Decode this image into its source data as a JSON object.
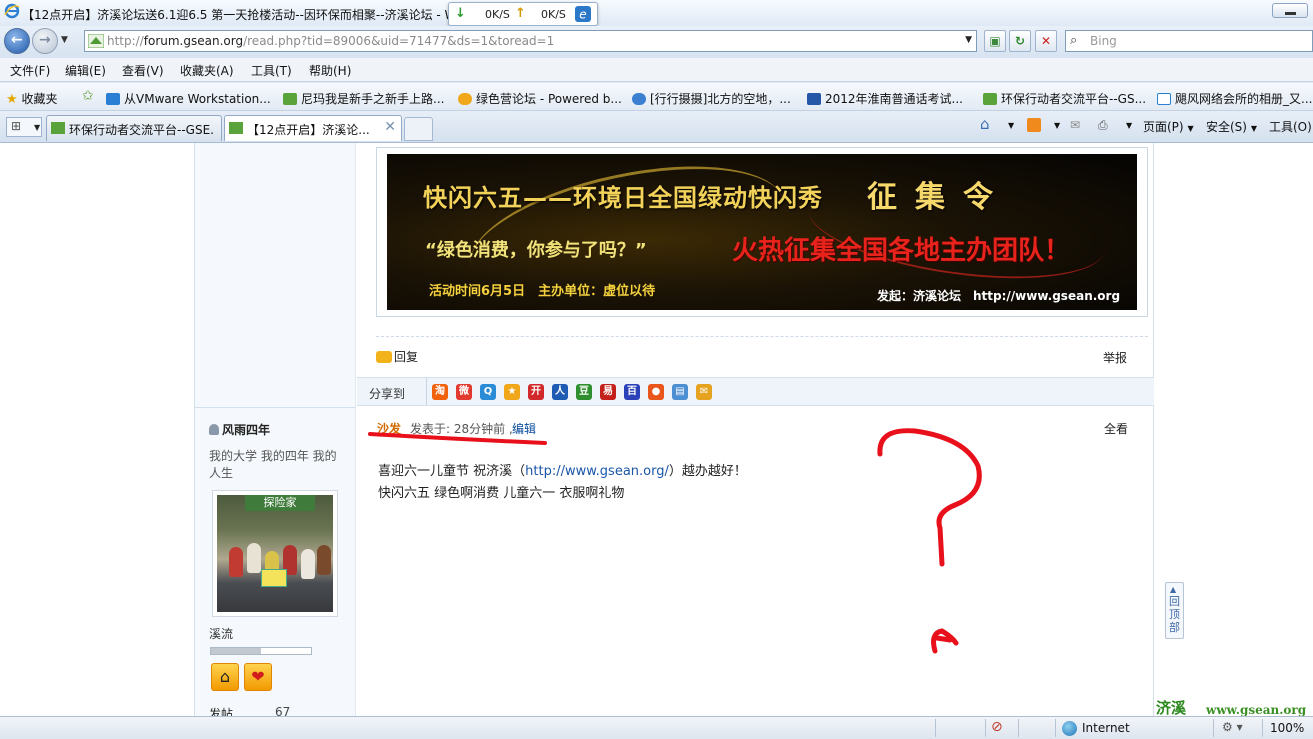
{
  "window": {
    "title": "【12点开启】济溪论坛送6.1迎6.5 第一天抢楼活动--因环保而相聚--济溪论坛 - W",
    "download_speed": "0K/S",
    "upload_speed": "0K/S"
  },
  "address_bar": {
    "url_prefix": "http://",
    "url_host": "forum.gsean.org",
    "url_path": "/read.php?tid=89006&uid=71477&ds=1&toread=1",
    "search_placeholder": "Bing"
  },
  "menu": [
    {
      "label": "文件(F)"
    },
    {
      "label": "编辑(E)"
    },
    {
      "label": "查看(V)"
    },
    {
      "label": "收藏夹(A)"
    },
    {
      "label": "工具(T)"
    },
    {
      "label": "帮助(H)"
    }
  ],
  "favorites": {
    "label": "收藏夹",
    "items": [
      {
        "label": "从VMware Workstation..."
      },
      {
        "label": "尼玛我是新手之新手上路..."
      },
      {
        "label": "绿色营论坛 - Powered b..."
      },
      {
        "label": "[行行摄摄]北方的空地，..."
      },
      {
        "label": "2012年淮南普通话考试..."
      },
      {
        "label": "环保行动者交流平台--GS..."
      },
      {
        "label": "飓风网络会所的相册_又..."
      }
    ]
  },
  "tabs": [
    {
      "label": "环保行动者交流平台--GSE..."
    },
    {
      "label": "【12点开启】济溪论..."
    }
  ],
  "commands": {
    "page": "页面(P)",
    "safety": "安全(S)",
    "tools": "工具(O)"
  },
  "banner": {
    "title": "快闪六五——环境日全国绿动快闪秀",
    "call": "征集令",
    "slogan": "“绿色消费，你参与了吗？”",
    "recruit": "火热征集全国各地主办团队！",
    "date_sponsor": "活动时间6月5日　主办单位：虚位以待",
    "initiator": "发起：济溪论坛　http://www.gsean.org"
  },
  "post_actions": {
    "reply": "回复",
    "report": "举报",
    "share_label": "分享到"
  },
  "share_icons": [
    {
      "name": "taobao",
      "glyph": "淘",
      "color": "#f2620b"
    },
    {
      "name": "weibo",
      "glyph": "微",
      "color": "#e23a2e"
    },
    {
      "name": "qzone",
      "glyph": "Q",
      "color": "#2a8bd6"
    },
    {
      "name": "favorite",
      "glyph": "★",
      "color": "#f0a81a"
    },
    {
      "name": "kaixin",
      "glyph": "开",
      "color": "#d3282b"
    },
    {
      "name": "renren",
      "glyph": "人",
      "color": "#1e5bb2"
    },
    {
      "name": "douban",
      "glyph": "豆",
      "color": "#2f8f2f"
    },
    {
      "name": "yixin",
      "glyph": "易",
      "color": "#c5211c"
    },
    {
      "name": "baidu",
      "glyph": "百",
      "color": "#2a41b8"
    },
    {
      "name": "apple",
      "glyph": "●",
      "color": "#e8561c"
    },
    {
      "name": "notes",
      "glyph": "▤",
      "color": "#4d8fd3"
    },
    {
      "name": "mail",
      "glyph": "✉",
      "color": "#e6a320"
    }
  ],
  "post": {
    "author": "风雨四年",
    "signature": "我的大学 我的四年 我的人生",
    "avatar_sign": "探险家",
    "group": "溪流",
    "level_progress": 0.5,
    "posts_label": "发帖",
    "posts_count": "67",
    "floor": "沙发",
    "posted": "发表于: 28分钟前 ,",
    "edit": "编辑",
    "view_all": "全看",
    "line1_before": "喜迎六一儿童节 祝济溪（",
    "line1_link": "http://www.gsean.org/",
    "line1_after": "）越办越好！",
    "line2": "快闪六五 绿色啊消费 儿童六一 衣服啊礼物"
  },
  "back_to_top": "回顶部",
  "watermark": {
    "name": "济溪",
    "url": "www.gsean.org"
  },
  "status": {
    "zone": "Internet",
    "zoom": "100%"
  },
  "colors": {
    "annotation": "#e8101a",
    "floor": "#d06a00",
    "link": "#1a56a8"
  }
}
